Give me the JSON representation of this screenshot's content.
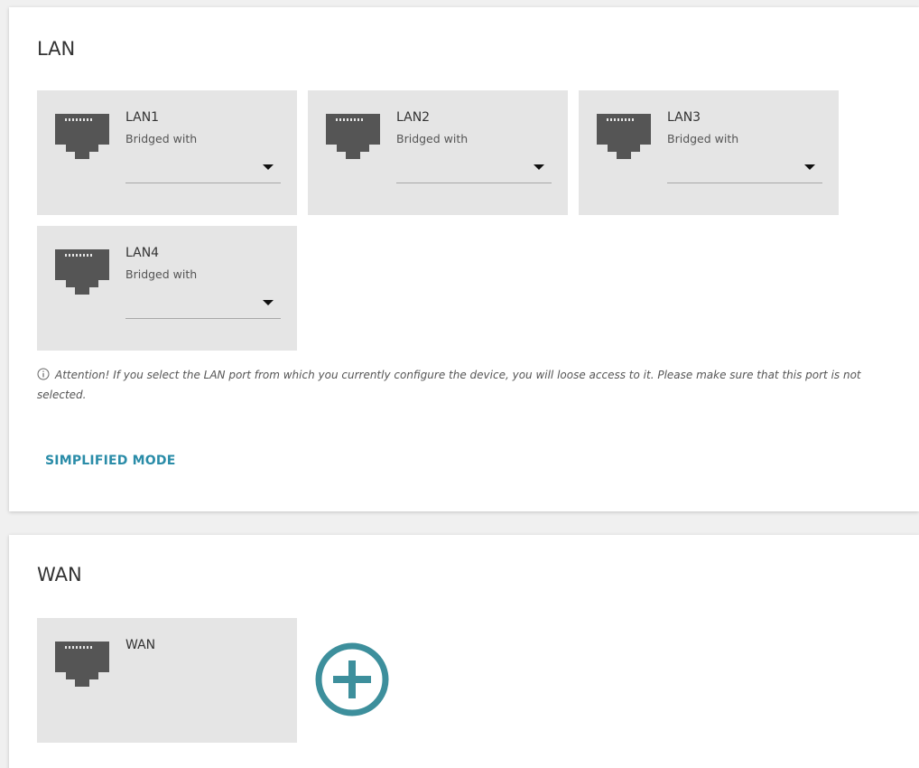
{
  "lan": {
    "title": "LAN",
    "ports": [
      {
        "name": "LAN1",
        "subtitle": "Bridged with",
        "selected": ""
      },
      {
        "name": "LAN2",
        "subtitle": "Bridged with",
        "selected": ""
      },
      {
        "name": "LAN3",
        "subtitle": "Bridged with",
        "selected": ""
      },
      {
        "name": "LAN4",
        "subtitle": "Bridged with",
        "selected": ""
      }
    ],
    "attention": "Attention! If you select the LAN port from which you currently configure the device, you will loose access to it. Please make sure that this port is not selected.",
    "simplified_mode_label": "SIMPLIFIED MODE"
  },
  "wan": {
    "title": "WAN",
    "ports": [
      {
        "name": "WAN"
      }
    ]
  },
  "icons": {
    "port": "ethernet-port-icon",
    "info": "info-icon",
    "add": "add-circle-icon",
    "dropdown": "caret-down-icon"
  },
  "colors": {
    "accent": "#2a8ca8",
    "tile_bg": "#e5e5e5",
    "port_icon": "#555555",
    "add_icon": "#3d8f9c"
  }
}
